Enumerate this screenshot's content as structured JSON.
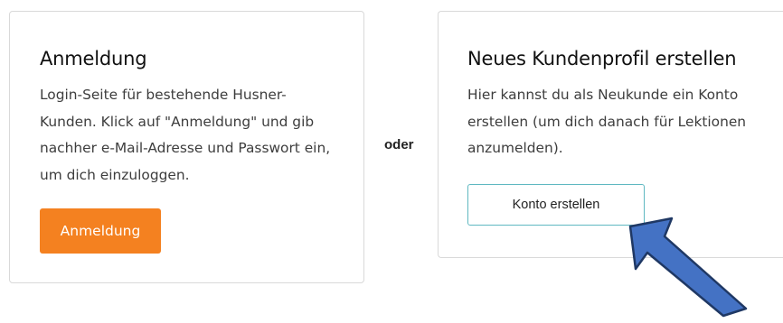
{
  "login_card": {
    "title": "Anmeldung",
    "description_lines": [
      "Login-Seite für bestehende Husner-",
      "Kunden. Klick auf \"Anmeldung\" und gib",
      "nachher e-Mail-Adresse und Passwort ein,",
      "um dich einzuloggen."
    ],
    "button_label": "Anmeldung"
  },
  "separator": "oder",
  "register_card": {
    "title": "Neues Kundenprofil erstellen",
    "description_lines": [
      "Hier kannst du als Neukunde ein Konto",
      "erstellen (um dich danach für Lektionen",
      "anzumelden)."
    ],
    "button_label": "Konto erstellen"
  },
  "annotation": {
    "icon": "pointer-arrow-icon",
    "color": "#4472c4",
    "outline_color": "#1f3864"
  },
  "colors": {
    "primary_button": "#f48120",
    "outline_button_border": "#5fb8c1",
    "card_border": "#d9d9d9"
  }
}
